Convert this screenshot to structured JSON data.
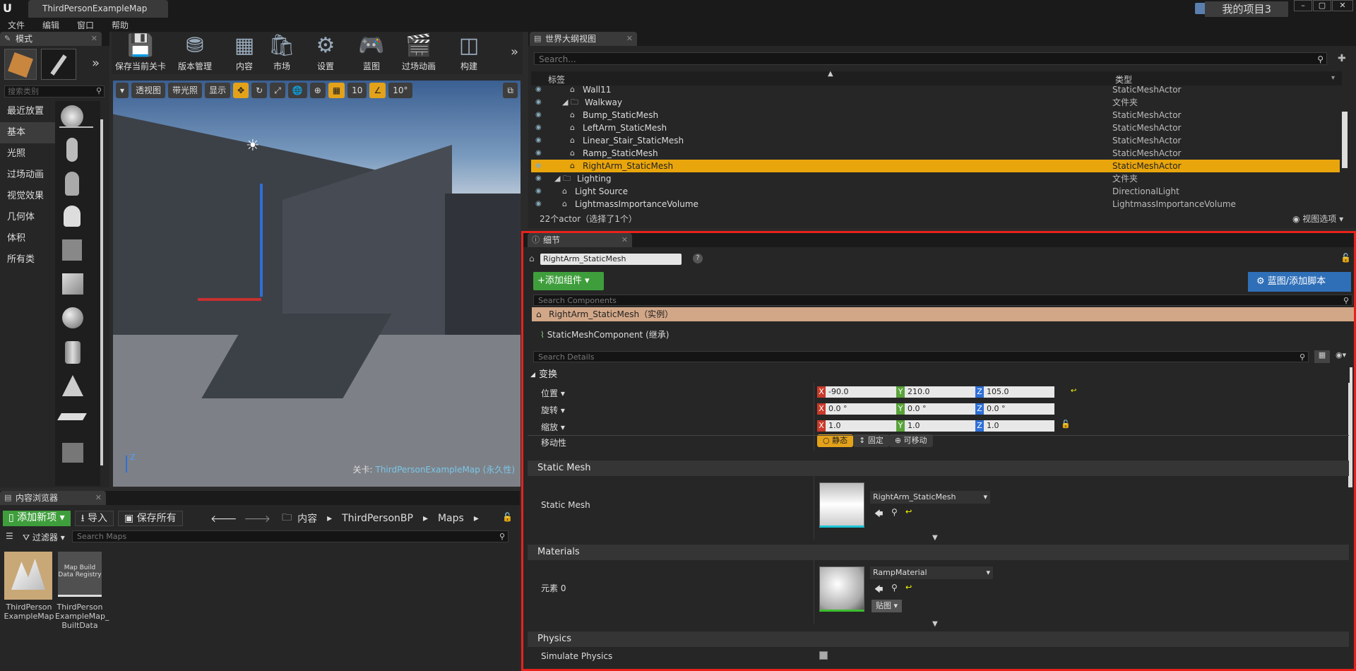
{
  "titlebar": {
    "doc_tab": "ThirdPersonExampleMap",
    "project_name": "我的项目3"
  },
  "menu": [
    "文件",
    "编辑",
    "窗口",
    "帮助"
  ],
  "modes": {
    "tab": "模式",
    "search_placeholder": "搜索类别",
    "categories": [
      "最近放置",
      "基本",
      "光照",
      "过场动画",
      "视觉效果",
      "几何体",
      "体积",
      "所有类"
    ],
    "active": "基本"
  },
  "toolbar": [
    "保存当前关卡",
    "版本管理",
    "内容",
    "市场",
    "设置",
    "蓝图",
    "过场动画",
    "构建"
  ],
  "viewport": {
    "perspective": "透视图",
    "lit": "带光照",
    "show": "显示",
    "grid": "10",
    "angle": "10°",
    "level_label": "关卡:",
    "level_name": "ThirdPersonExampleMap (永久性)",
    "axis_z": "Z"
  },
  "outliner": {
    "tab": "世界大纲视图",
    "search_placeholder": "Search...",
    "col_label": "标签",
    "col_type": "类型",
    "rows": [
      {
        "label": "Wall11",
        "type": "StaticMeshActor",
        "indent": 3
      },
      {
        "label": "Walkway",
        "type": "文件夹",
        "indent": 2
      },
      {
        "label": "Bump_StaticMesh",
        "type": "StaticMeshActor",
        "indent": 3
      },
      {
        "label": "LeftArm_StaticMesh",
        "type": "StaticMeshActor",
        "indent": 3
      },
      {
        "label": "Linear_Stair_StaticMesh",
        "type": "StaticMeshActor",
        "indent": 3
      },
      {
        "label": "Ramp_StaticMesh",
        "type": "StaticMeshActor",
        "indent": 3
      },
      {
        "label": "RightArm_StaticMesh",
        "type": "StaticMeshActor",
        "indent": 3,
        "selected": true
      },
      {
        "label": "Lighting",
        "type": "文件夹",
        "indent": 1
      },
      {
        "label": "Light Source",
        "type": "DirectionalLight",
        "indent": 2
      },
      {
        "label": "LightmassImportanceVolume",
        "type": "LightmassImportanceVolume",
        "indent": 2
      }
    ],
    "status": "22个actor（选择了1个）",
    "view_options": "视图选项"
  },
  "details": {
    "tab": "细节",
    "name": "RightArm_StaticMesh",
    "add_component": "+添加组件",
    "blueprint": "蓝图/添加脚本",
    "search_components": "Search Components",
    "root_component": "RightArm_StaticMesh（实例）",
    "child_component": "StaticMeshComponent (继承)",
    "search_details": "Search Details",
    "transform": {
      "title": "变换",
      "location_label": "位置",
      "rotation_label": "旋转",
      "scale_label": "缩放",
      "mobility_label": "移动性",
      "location": [
        "-90.0",
        "210.0",
        "105.0"
      ],
      "rotation": [
        "0.0 °",
        "0.0 °",
        "0.0 °"
      ],
      "scale": [
        "1.0",
        "1.0",
        "1.0"
      ],
      "mobility": [
        "静态",
        "固定",
        "可移动"
      ]
    },
    "static_mesh": {
      "title": "Static Mesh",
      "label": "Static Mesh",
      "value": "RightArm_StaticMesh"
    },
    "materials": {
      "title": "Materials",
      "label": "元素 0",
      "value": "RampMaterial",
      "texture_btn": "贴图"
    },
    "physics": {
      "title": "Physics",
      "simulate": "Simulate Physics"
    }
  },
  "content_browser": {
    "tab": "内容浏览器",
    "add_new": "添加新项",
    "import": "导入",
    "save_all": "保存所有",
    "path": [
      "内容",
      "ThirdPersonBP",
      "Maps"
    ],
    "filter": "过滤器",
    "search_placeholder": "Search Maps",
    "assets": [
      {
        "name": "ThirdPerson ExampleMap",
        "thumb_text": ""
      },
      {
        "name": "ThirdPerson ExampleMap_ BuiltData",
        "thumb_text": "Map Build Data Registry"
      }
    ]
  }
}
